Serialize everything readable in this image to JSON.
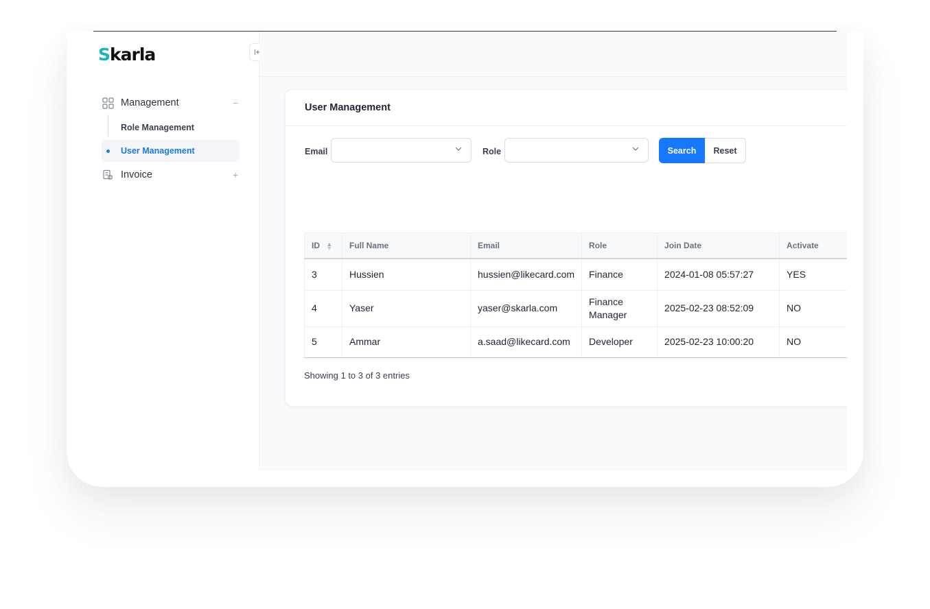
{
  "app": {
    "logo_first": "S",
    "logo_rest": "karla",
    "collapse_icon": "collapse-left-icon"
  },
  "sidebar": {
    "groups": [
      {
        "label": "Management",
        "icon": "grid-icon",
        "toggle": "−",
        "items": [
          {
            "label": "Role Management",
            "active": false
          },
          {
            "label": "User Management",
            "active": true
          }
        ]
      },
      {
        "label": "Invoice",
        "icon": "invoice-icon",
        "toggle": "+"
      }
    ]
  },
  "page": {
    "title": "User Management"
  },
  "filters": {
    "email_label": "Email",
    "email_value": "",
    "role_label": "Role",
    "role_value": "",
    "search_label": "Search",
    "reset_label": "Reset"
  },
  "table": {
    "columns": [
      "ID",
      "Full Name",
      "Email",
      "Role",
      "Join Date",
      "Activate"
    ],
    "rows": [
      {
        "id": "3",
        "name": "Hussien",
        "email": "hussien@likecard.com",
        "role": "Finance",
        "join": "2024-01-08 05:57:27",
        "activate": "YES"
      },
      {
        "id": "4",
        "name": "Yaser",
        "email": "yaser@skarla.com",
        "role": "Finance Manager",
        "join": "2025-02-23 08:52:09",
        "activate": "NO"
      },
      {
        "id": "5",
        "name": "Ammar",
        "email": "a.saad@likecard.com",
        "role": "Developer",
        "join": "2025-02-23 10:00:20",
        "activate": "NO"
      }
    ],
    "info": "Showing 1 to 3 of 3 entries"
  },
  "colors": {
    "accent": "#1677ff",
    "logo_teal": "#18b3c0"
  }
}
